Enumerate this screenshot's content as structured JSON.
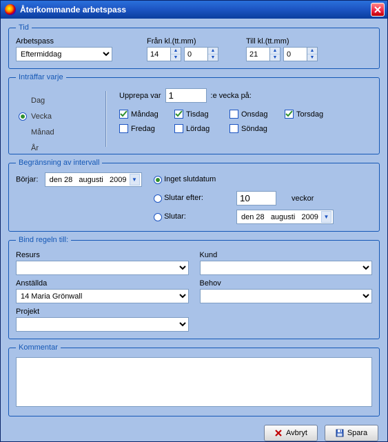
{
  "window": {
    "title": "Återkommande arbetspass"
  },
  "tid": {
    "legend": "Tid",
    "arbetspass_label": "Arbetspass",
    "arbetspass_value": "Eftermiddag",
    "from_label": "Från kl.(tt.mm)",
    "from_hour": "14",
    "from_min": "0",
    "to_label": "Till kl.(tt.mm)",
    "to_hour": "21",
    "to_min": "0"
  },
  "recur": {
    "legend": "Inträffar varje",
    "tabs": {
      "dag": "Dag",
      "vecka": "Vecka",
      "manad": "Månad",
      "ar": "År"
    },
    "repeat_prefix": "Upprepa var",
    "repeat_value": "1",
    "repeat_suffix": ":e vecka på:",
    "days": {
      "mon": {
        "label": "Måndag",
        "checked": true
      },
      "tue": {
        "label": "Tisdag",
        "checked": true
      },
      "wed": {
        "label": "Onsdag",
        "checked": false
      },
      "thu": {
        "label": "Torsdag",
        "checked": true
      },
      "fri": {
        "label": "Fredag",
        "checked": false
      },
      "sat": {
        "label": "Lördag",
        "checked": false
      },
      "sun": {
        "label": "Söndag",
        "checked": false
      }
    }
  },
  "range": {
    "legend": "Begränsning av intervall",
    "start_label": "Börjar:",
    "start_date": "den 28   augusti   2009",
    "opt_noend": "Inget slutdatum",
    "opt_after": "Slutar efter:",
    "after_value": "10",
    "after_unit": "veckor",
    "opt_on": "Slutar:",
    "end_date": "den 28   augusti   2009"
  },
  "bind": {
    "legend": "Bind regeln till:",
    "resurs_label": "Resurs",
    "resurs_value": "",
    "kund_label": "Kund",
    "kund_value": "",
    "anstallda_label": "Anställda",
    "anstallda_value": "14 Maria Grönwall",
    "behov_label": "Behov",
    "behov_value": "",
    "projekt_label": "Projekt",
    "projekt_value": ""
  },
  "comment": {
    "legend": "Kommentar",
    "value": ""
  },
  "buttons": {
    "cancel": "Avbryt",
    "save": "Spara"
  }
}
